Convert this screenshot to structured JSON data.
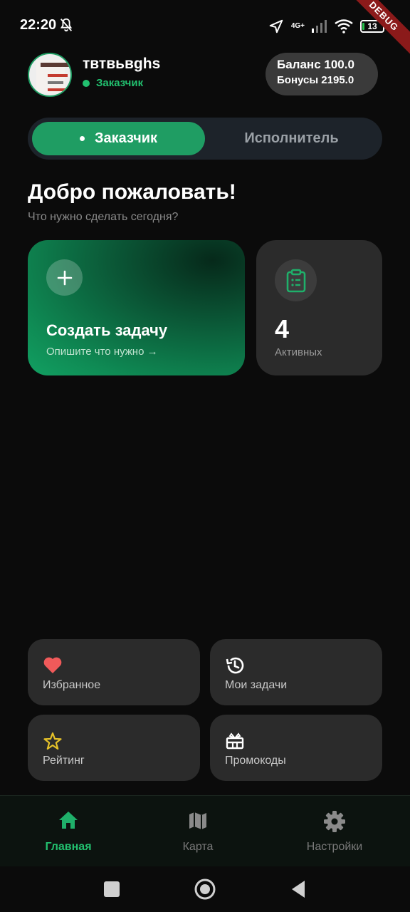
{
  "status_bar": {
    "time": "22:20",
    "network": "4G+",
    "battery": "13",
    "debug_banner": "DEBUG"
  },
  "header": {
    "user_name": "твтвьвghs",
    "role": "Заказчик",
    "balance": "Баланс 100.0",
    "bonus": "Бонусы 2195.0"
  },
  "mode_switch": {
    "active": "Заказчик",
    "inactive": "Исполнитель"
  },
  "welcome": {
    "title": "Добро пожаловать!",
    "subtitle": "Что нужно сделать сегодня?"
  },
  "create_card": {
    "title": "Создать задачу",
    "subtitle": "Опишите что нужно →"
  },
  "active_card": {
    "count": "4",
    "label": "Активных"
  },
  "quick_actions": [
    {
      "label": "Избранное",
      "icon": "heart-icon"
    },
    {
      "label": "Мои задачи",
      "icon": "history-icon"
    },
    {
      "label": "Рейтинг",
      "icon": "star-icon"
    },
    {
      "label": "Промокоды",
      "icon": "gift-icon"
    }
  ],
  "bottom_nav": [
    {
      "label": "Главная",
      "icon": "home-icon",
      "active": true
    },
    {
      "label": "Карта",
      "icon": "map-icon",
      "active": false
    },
    {
      "label": "Настройки",
      "icon": "gear-icon",
      "active": false
    }
  ],
  "colors": {
    "accent": "#1f9d63",
    "accent_text": "#22c06f",
    "background": "#0b0b0b",
    "card": "#2b2b2b",
    "heart": "#f05a5a",
    "star": "#e6c229"
  }
}
